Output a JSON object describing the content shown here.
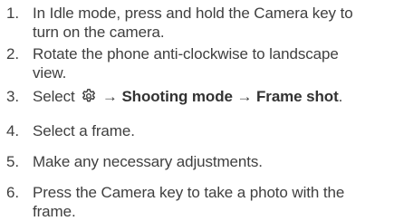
{
  "steps": [
    {
      "number": "1.",
      "line1": "In Idle mode, press and hold the Camera key to",
      "line2": "turn on the camera."
    },
    {
      "number": "2.",
      "line1": "Rotate the phone anti-clockwise to landscape",
      "line2": "view."
    },
    {
      "number": "3.",
      "prefix": "Select",
      "icon": "settings-gear-icon",
      "arrow1": "→",
      "bold1": "Shooting mode",
      "arrow2": "→",
      "bold2": "Frame shot",
      "suffix": "."
    },
    {
      "number": "4.",
      "line1": "Select a frame."
    },
    {
      "number": "5.",
      "line1": "Make any necessary adjustments."
    },
    {
      "number": "6.",
      "line1": "Press the Camera key to take a photo with the",
      "line2": "frame."
    }
  ]
}
